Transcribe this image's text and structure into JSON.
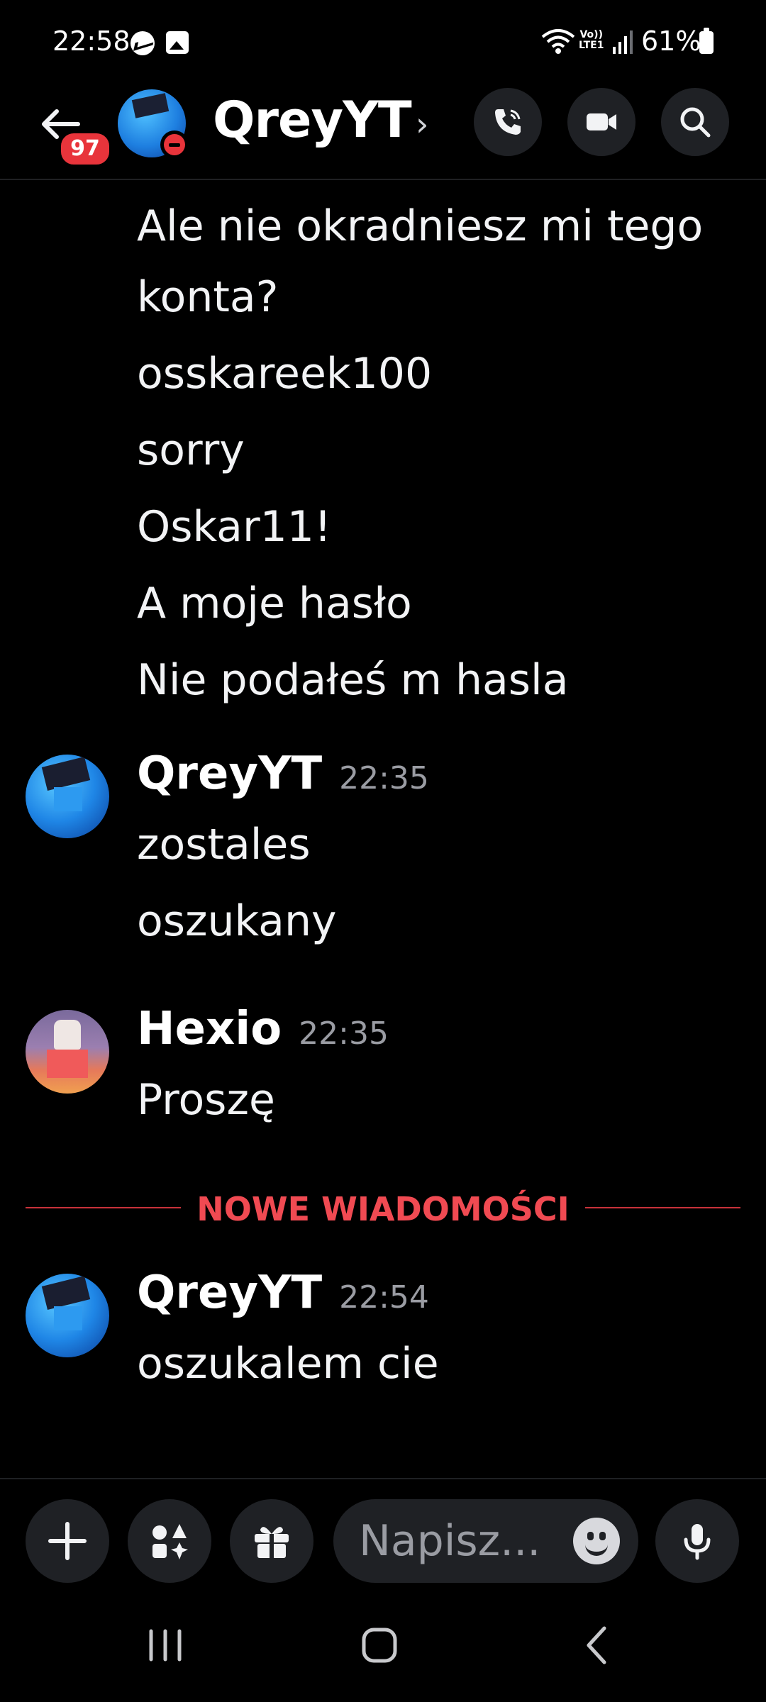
{
  "status_bar": {
    "time": "22:58",
    "network_label_top": "Vo))",
    "network_label_bottom": "LTE1",
    "battery": "61%",
    "icons": [
      "messenger-icon",
      "gallery-icon",
      "wifi-icon",
      "signal-icon",
      "battery-icon"
    ]
  },
  "header": {
    "unread_count": "97",
    "contact_name": "QreyYT",
    "chevron": "›",
    "status": "do-not-disturb",
    "actions": [
      "call-icon",
      "video-icon",
      "search-icon"
    ]
  },
  "messages": {
    "continued_lines": [
      "Ale nie okradniesz mi tego",
      "konta?",
      "osskareek100",
      "sorry",
      "Oskar11!",
      "A moje hasło",
      "Nie podałeś m hasla"
    ],
    "groups": [
      {
        "author": "QreyYT",
        "time": "22:35",
        "lines": [
          "zostales",
          "oszukany"
        ]
      },
      {
        "author": "Hexio",
        "time": "22:35",
        "lines": [
          "Proszę"
        ]
      },
      {
        "author": "QreyYT",
        "time": "22:54",
        "lines": [
          "oszukalem cie"
        ]
      }
    ],
    "new_messages_divider": "NOWE WIADOMOŚCI"
  },
  "composer": {
    "placeholder": "Napisz..."
  },
  "colors": {
    "background": "#000000",
    "accent_red": "#e8343b",
    "surface": "#1f2125",
    "timestamp": "#9a9ca3"
  }
}
